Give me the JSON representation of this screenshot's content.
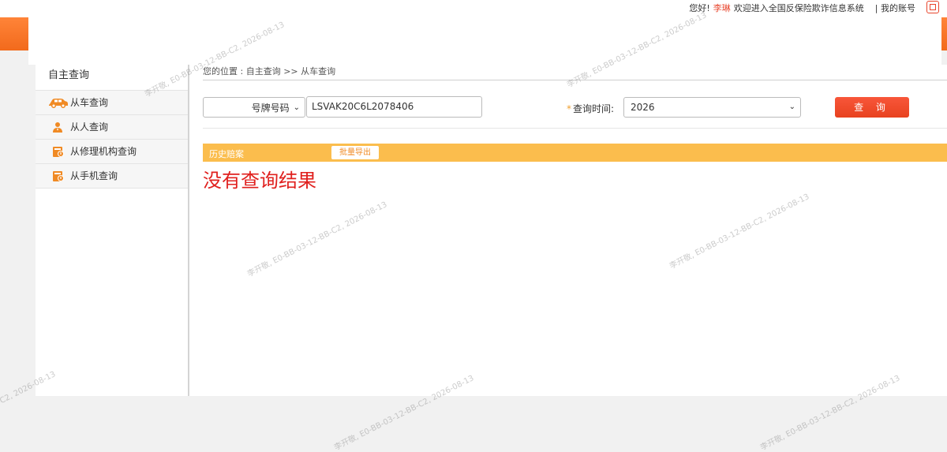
{
  "header": {
    "greeting": "您好!",
    "username": "李琳",
    "welcome": "欢迎进入全国反保险欺诈信息系统",
    "logout": "| 我的账号",
    "brand_color": "#f26a1c"
  },
  "sidebar": {
    "title": "自主查询",
    "items": [
      {
        "label": "从车查询",
        "icon": "car-icon"
      },
      {
        "label": "从人查询",
        "icon": "person-icon"
      },
      {
        "label": "从修理机构查询",
        "icon": "repair-icon"
      },
      {
        "label": "从手机查询",
        "icon": "phone-icon"
      }
    ]
  },
  "breadcrumb": "您的位置 : 自主查询 >> 从车查询",
  "form": {
    "search_type": "号牌号码",
    "vin_value": "LSVAK20C6L2078406",
    "time_label": "查询时间:",
    "required_mark": "*",
    "year": "2026",
    "query_button": "查 询"
  },
  "results": {
    "section_title": "历史赔案",
    "export_button": "批量导出",
    "empty_message": "没有查询结果"
  },
  "watermark": "李开敬, E0-BB-03-12-BB-C2, 2026-08-13"
}
